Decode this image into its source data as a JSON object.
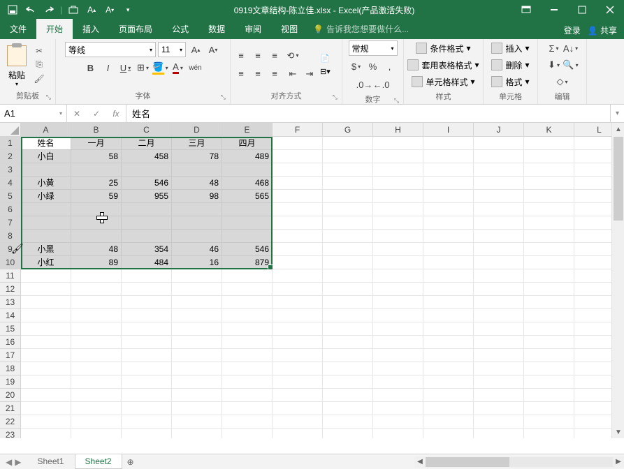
{
  "title": "0919文章结构-陈立佳.xlsx - Excel(产品激活失败)",
  "menu": {
    "file": "文件",
    "home": "开始",
    "insert": "插入",
    "layout": "页面布局",
    "formula": "公式",
    "data": "数据",
    "review": "审阅",
    "view": "视图",
    "tellme": "告诉我您想要做什么...",
    "login": "登录",
    "share": "共享"
  },
  "ribbon": {
    "clipboard": {
      "label": "剪贴板",
      "paste": "粘贴"
    },
    "font": {
      "label": "字体",
      "name": "等线",
      "size": "11",
      "bold": "B",
      "italic": "I",
      "underline": "U",
      "ruby": "wén"
    },
    "align": {
      "label": "对齐方式",
      "wrap": "自动换行",
      "merge": "合并后居中"
    },
    "number": {
      "label": "数字",
      "format": "常规",
      "currency": "%"
    },
    "styles": {
      "label": "样式",
      "cond": "条件格式",
      "table": "套用表格格式",
      "cell": "单元格样式"
    },
    "cells": {
      "label": "单元格",
      "insert": "插入",
      "delete": "删除",
      "format": "格式"
    },
    "editing": {
      "label": "编辑"
    }
  },
  "namebox": "A1",
  "formula": "姓名",
  "cols": [
    "A",
    "B",
    "C",
    "D",
    "E",
    "F",
    "G",
    "H",
    "I",
    "J",
    "K",
    "L"
  ],
  "rowcount": 23,
  "selcols": 5,
  "selrows": 10,
  "chart_data": {
    "type": "table",
    "headers": [
      "姓名",
      "一月",
      "二月",
      "三月",
      "四月"
    ],
    "rows": [
      [
        "小白",
        58,
        458,
        78,
        489
      ],
      [
        "",
        "",
        "",
        "",
        ""
      ],
      [
        "小黄",
        25,
        546,
        48,
        468
      ],
      [
        "小绿",
        59,
        955,
        98,
        565
      ],
      [
        "",
        "",
        "",
        "",
        ""
      ],
      [
        "",
        "",
        "",
        "",
        ""
      ],
      [
        "",
        "",
        "",
        "",
        ""
      ],
      [
        "小黑",
        48,
        354,
        46,
        546
      ],
      [
        "小红",
        89,
        484,
        16,
        879
      ]
    ]
  },
  "sheets": {
    "s1": "Sheet1",
    "s2": "Sheet2"
  }
}
